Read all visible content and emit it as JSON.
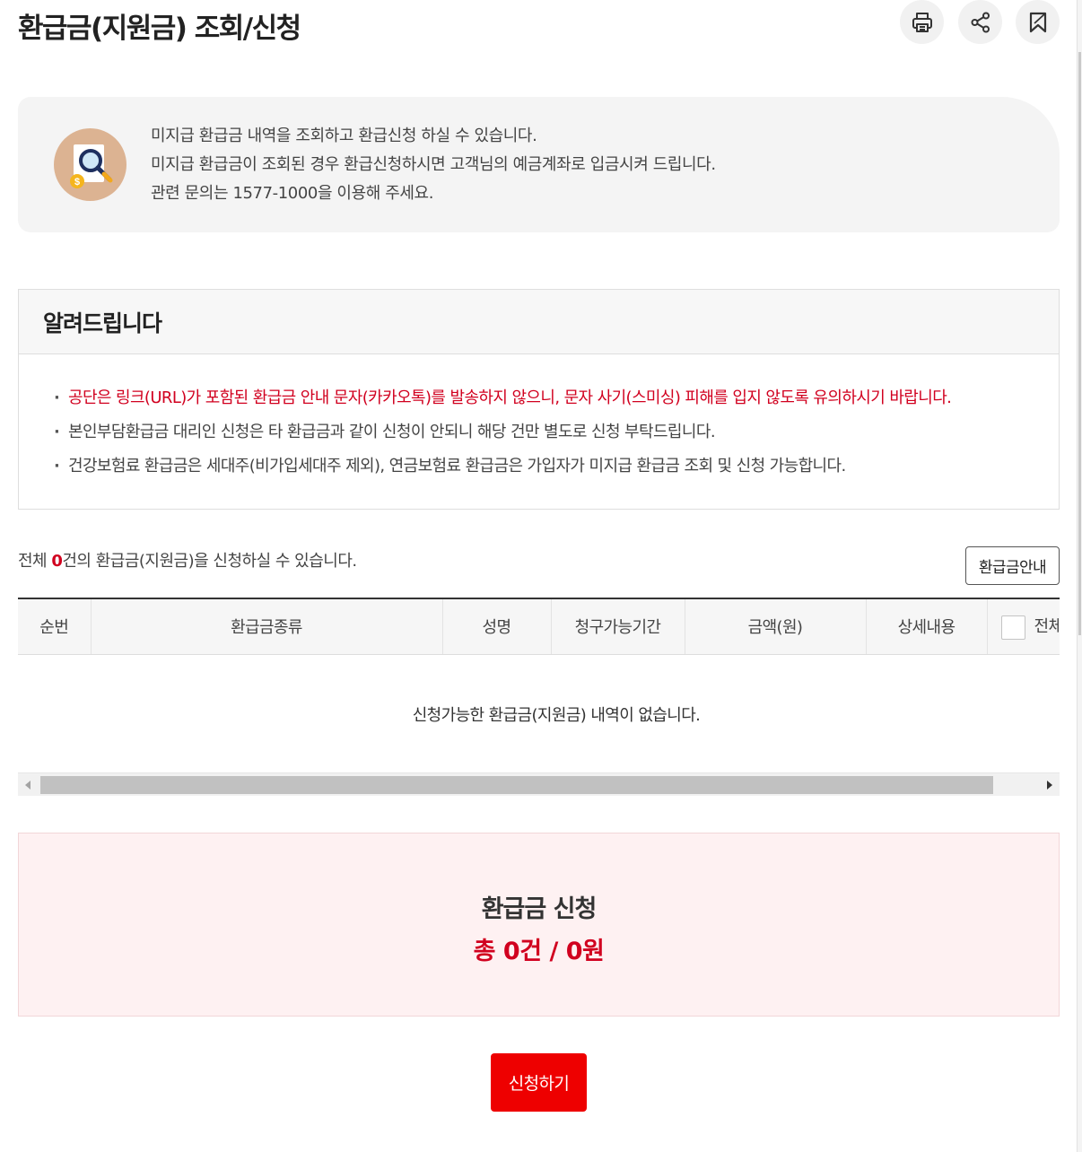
{
  "header": {
    "title": "환급금(지원금) 조회/신청",
    "tools": [
      {
        "name": "print",
        "icon": "printer-icon"
      },
      {
        "name": "share",
        "icon": "share-icon"
      },
      {
        "name": "bookmark",
        "icon": "bookmark-icon"
      }
    ]
  },
  "intro": {
    "icon": "magnifier-document-coin-icon",
    "lines": [
      "미지급 환급금 내역을 조회하고 환급신청 하실 수 있습니다.",
      "미지급 환급금이 조회된 경우 환급신청하시면 고객님의 예금계좌로 입금시켜 드립니다.",
      "관련 문의는 1577-1000을 이용해 주세요."
    ]
  },
  "notice": {
    "title": "알려드립니다",
    "items": [
      {
        "text": "공단은 링크(URL)가 포함된 환급금 안내 문자(카카오톡)를 발송하지 않으니, 문자 사기(스미싱) 피해를 입지 않도록 유의하시기 바랍니다.",
        "highlight": true
      },
      {
        "text": "본인부담환급금 대리인 신청은 타 환급금과 같이 신청이 안되니 해당 건만 별도로 신청 부탁드립니다.",
        "highlight": false
      },
      {
        "text": "건강보험료 환급금은 세대주(비가입세대주 제외), 연금보험료 환급금은 가입자가 미지급 환급금 조회 및 신청 가능합니다.",
        "highlight": false
      }
    ]
  },
  "summary": {
    "prefix": "전체 ",
    "count": "0",
    "suffix": "건의 환급금(지원금)을 신청하실 수 있습니다.",
    "guide_button": "환급금안내"
  },
  "table": {
    "columns": [
      "순번",
      "환급금종류",
      "성명",
      "청구가능기간",
      "금액(원)",
      "상세내용",
      "전체"
    ],
    "empty_message": "신청가능한 환급금(지원금) 내역이 없습니다.",
    "rows": []
  },
  "apply": {
    "title": "환급금 신청",
    "total": "총 0건 / 0원",
    "button": "신청하기"
  },
  "colors": {
    "accent_red": "#d1001f",
    "button_red": "#ee0000",
    "apply_bg": "#fef1f2"
  }
}
